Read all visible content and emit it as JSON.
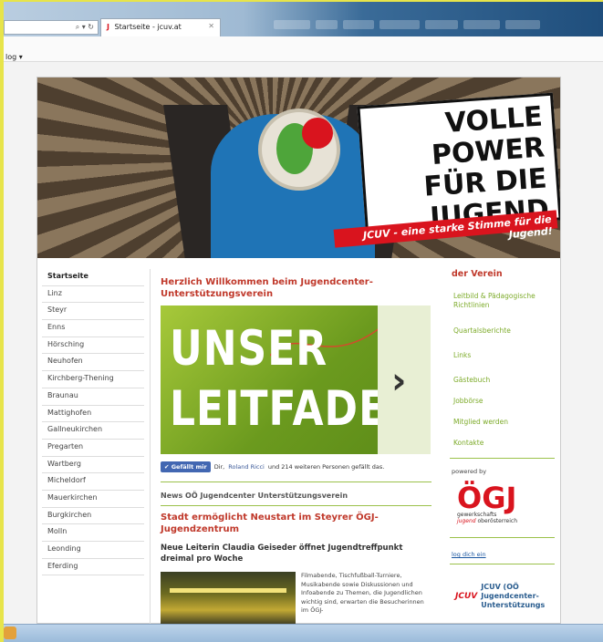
{
  "browser": {
    "tab_title": "Startseite - jcuv.at",
    "addr_icons": "⌕ ▾ ↻",
    "toolbar_item": "log ▾"
  },
  "banner": {
    "slogan_lines": [
      "VOLLE POWER",
      "FÜR DIE",
      "JUGEND"
    ],
    "sub_slogan": "JCUV - eine starke Stimme für die Jugend!"
  },
  "leftnav": {
    "items": [
      "Startseite",
      "Linz",
      "Steyr",
      "Enns",
      "Hörsching",
      "Neuhofen",
      "Kirchberg-Thening",
      "Braunau",
      "Mattighofen",
      "Gallneukirchen",
      "Pregarten",
      "Wartberg",
      "Micheldorf",
      "Mauerkirchen",
      "Burgkirchen",
      "Molln",
      "Leonding",
      "Eferding"
    ]
  },
  "main": {
    "welcome_title": "Herzlich Willkommen beim Jugendcenter-Unterstützungsverein",
    "leitfaden_line1": "UNSER",
    "leitfaden_line2": "LEITFADEN",
    "fb_like": "✔ Gefällt mir",
    "fb_pre": "Dir,",
    "fb_name": "Roland Ricci",
    "fb_post": "und 214 weiteren Personen gefällt das.",
    "news_heading": "News OÖ Jugendcenter Unterstützungsverein",
    "article_title": "Stadt ermöglicht Neustart im Steyrer ÖGJ-Jugendzentrum",
    "article_sub": "Neue Leiterin Claudia Geiseder öffnet Jugendtreffpunkt dreimal pro Woche",
    "article_text": "Filmabende, Tischfußball-Turniere, Musikabende sowie Diskussionen und Infoabende zu Themen, die Jugendlichen wichtig sind, erwarten die Besucherinnen im ÖGJ-"
  },
  "right": {
    "title": "der Verein",
    "links": [
      "Leitbild & Pädagogische Richtlinien",
      "Quartalsberichte",
      "Links",
      "Gästebuch",
      "Jobbörse",
      "Mitglied werden",
      "Kontakte"
    ],
    "powered": "powered by",
    "ogj_letters": "ÖGJ",
    "ogj_sub1": "gewerkschafts",
    "ogj_sub2": "jugend",
    "ogj_sub3": "oberösterreich",
    "login": "log dich ein",
    "jcuv_mini": "JCUV",
    "jcuv_text": "JCUV (OÖ Jugendcenter-Unterstützungs"
  }
}
